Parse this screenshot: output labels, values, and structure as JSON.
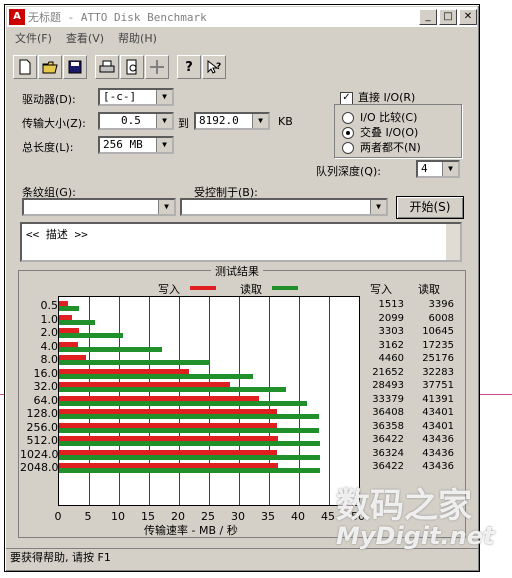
{
  "window": {
    "title": "无标题 - ATTO Disk Benchmark"
  },
  "menu": [
    "文件(F)",
    "查看(V)",
    "帮助(H)"
  ],
  "form": {
    "drive_label": "驱动器(D):",
    "drive_value": "[-c-]",
    "transfer_label": "传输大小(Z):",
    "transfer_from": "0.5",
    "to_label": "到",
    "transfer_to": "8192.0",
    "kb": "KB",
    "total_label": "总长度(L):",
    "total_value": "256 MB",
    "direct_io": "直接 I/O(R)",
    "io_compare": "I/O 比较(C)",
    "overlap_io": "交叠 I/O(O)",
    "neither": "两者都不(N)",
    "queue_label": "队列深度(Q):",
    "queue_value": "4",
    "stripe_label": "条纹组(G):",
    "controlled_label": "受控制于(B):",
    "start_button": "开始(S)",
    "description": "<< 描述 >>"
  },
  "results": {
    "title": "测试结果",
    "legend_write": "写入",
    "legend_read": "读取",
    "col_write": "写入",
    "col_read": "读取",
    "xlabel": "传输速率 - MB / 秒"
  },
  "status": "要获得帮助, 请按 F1",
  "watermark": {
    "line1": "数码之家",
    "line2": "MyDigit.net"
  },
  "colors": {
    "write": "#e02020",
    "read": "#20902a"
  },
  "chart_data": {
    "type": "bar",
    "categories": [
      "0.5",
      "1.0",
      "2.0",
      "4.0",
      "8.0",
      "16.0",
      "32.0",
      "64.0",
      "128.0",
      "256.0",
      "512.0",
      "1024.0",
      "2048.0"
    ],
    "xlim": [
      0,
      50
    ],
    "xticks": [
      "0",
      "5",
      "10",
      "15",
      "20",
      "25",
      "30",
      "35",
      "40",
      "45",
      "50"
    ],
    "series": [
      {
        "name": "写入",
        "values": [
          1513,
          2099,
          3303,
          3162,
          4460,
          21652,
          28493,
          33379,
          36408,
          36358,
          36422,
          36324,
          36422
        ]
      },
      {
        "name": "读取",
        "values": [
          3396,
          6008,
          10645,
          17235,
          25176,
          32283,
          37751,
          41391,
          43401,
          43401,
          43436,
          43436,
          43436
        ]
      }
    ]
  }
}
